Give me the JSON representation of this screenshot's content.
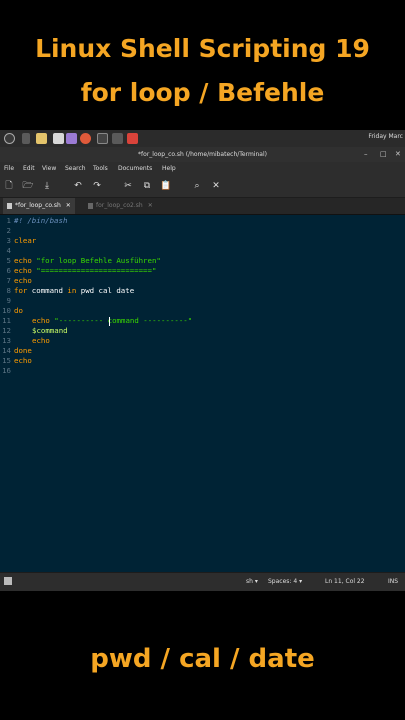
{
  "caption": {
    "title_line_1": "Linux Shell Scripting 19",
    "title_line_2": "for loop / Befehle",
    "footer": "pwd / cal / date"
  },
  "panel": {
    "clock": "Friday Marc",
    "icons": [
      "start-menu-icon",
      "show-desktop-icon",
      "files-icon",
      "text-editor-icon",
      "software-icon",
      "app-icon",
      "terminal-icon",
      "app-icon-2"
    ]
  },
  "window": {
    "title": "*for_loop_co.sh (/home/mibatech/Terminal)",
    "minimize": "–",
    "maximize": "□",
    "close": "✕"
  },
  "menu": [
    "File",
    "Edit",
    "View",
    "Search",
    "Tools",
    "Documents",
    "Help"
  ],
  "tabs": [
    {
      "label": "*for_loop_co.sh",
      "close": "✕",
      "active": true
    },
    {
      "label": "for_loop_co2.sh",
      "close": "✕",
      "active": false
    }
  ],
  "editor": {
    "line_numbers": [
      "1",
      "2",
      "3",
      "4",
      "5",
      "6",
      "7",
      "8",
      "9",
      "10",
      "11",
      "12",
      "13",
      "14",
      "15",
      "16"
    ],
    "lines": {
      "l1": "#! /bin/bash",
      "l3": "clear",
      "l5_kw": "echo",
      "l5_str": " \"for loop Befehle Ausführen\"",
      "l6_kw": "echo",
      "l6_str": " \"=========================\"",
      "l7": "echo",
      "l8_kw1": "for",
      "l8_a": " command ",
      "l8_kw2": "in",
      "l8_b": " pwd cal date",
      "l10": "do",
      "l11_kw": "echo",
      "l11_str": " \"---------- command ----------\"",
      "l12": "$command",
      "l13": "echo",
      "l14": "done",
      "l15": "echo"
    }
  },
  "status": {
    "language": "sh",
    "spaces": "Spaces: 4",
    "position": "Ln 11, Col 22",
    "mode": "INS"
  },
  "colors": {
    "caption": "#f5a623",
    "editor_bg": "#002335",
    "keyword": "#ff9d00",
    "string": "#3ad900",
    "variable": "#ccff66"
  }
}
